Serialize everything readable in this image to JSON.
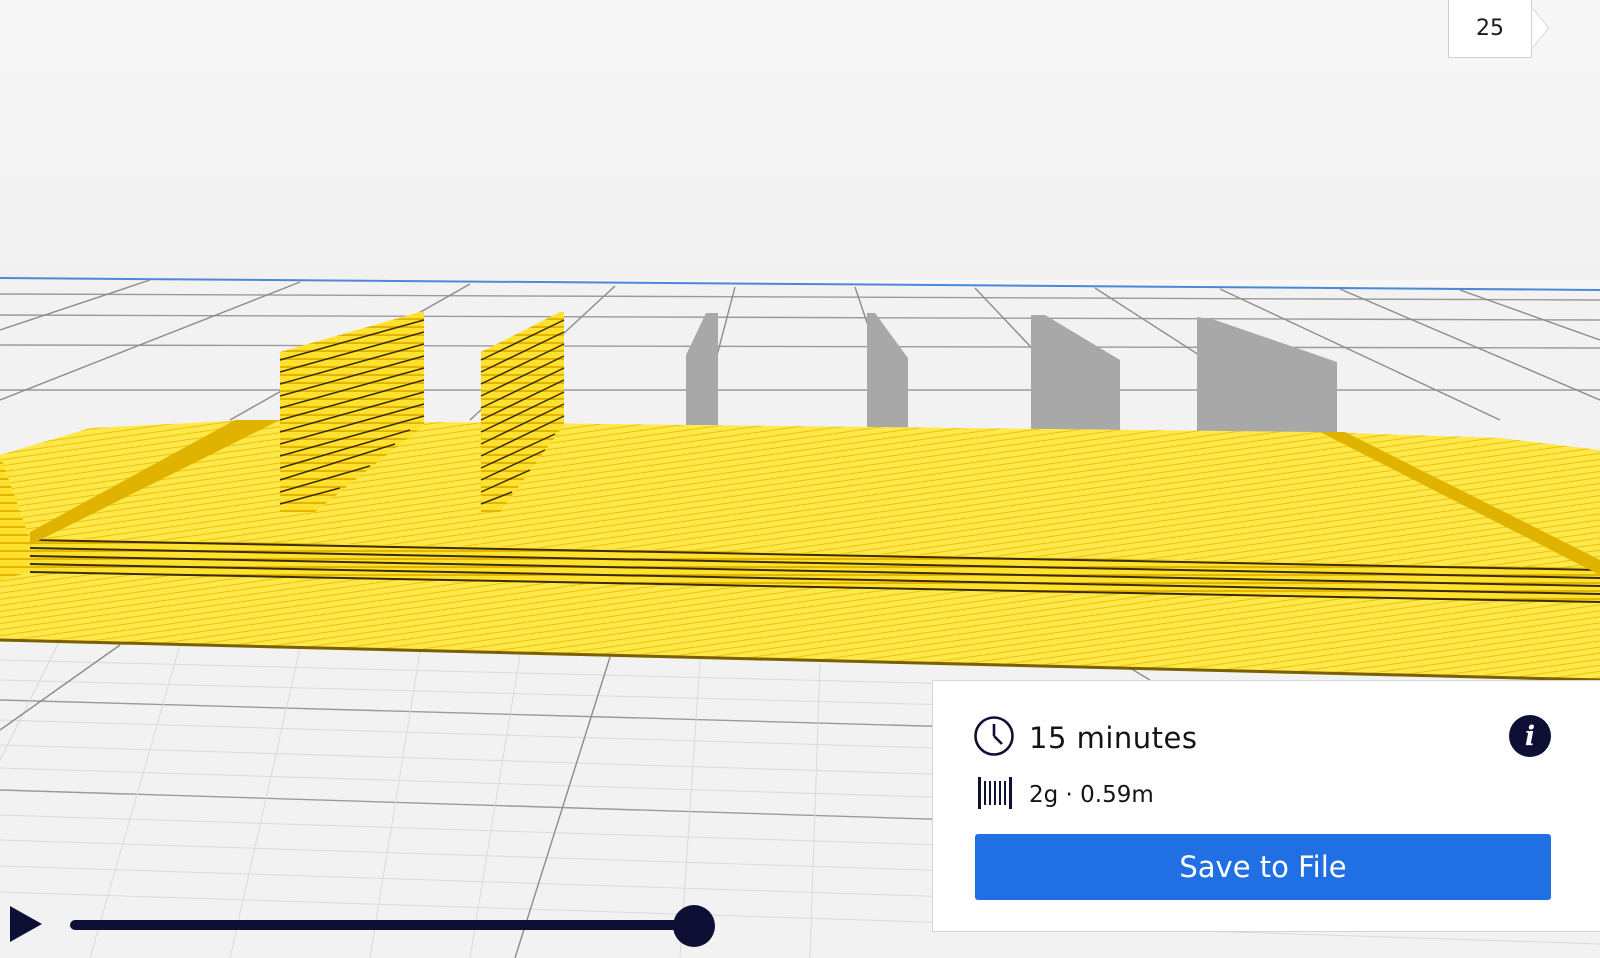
{
  "layer_view": {
    "current_layer": "25"
  },
  "print_info": {
    "time_icon": "clock-icon",
    "time_estimate": "15 minutes",
    "info_icon": "info-icon",
    "info_glyph": "i",
    "material_icon": "spool-icon",
    "material_usage": "2g · 0.59m",
    "save_button_label": "Save to File"
  },
  "simulation": {
    "play_icon": "play-icon",
    "progress": 1.0
  },
  "colors": {
    "print_yellow": "#ffe12e",
    "print_shadow": "#b38a00",
    "unprinted_gray": "#a8a8a8",
    "grid_line": "#8c8c8c",
    "accent_blue": "#2170e3",
    "dark_navy": "#0e0f35"
  }
}
